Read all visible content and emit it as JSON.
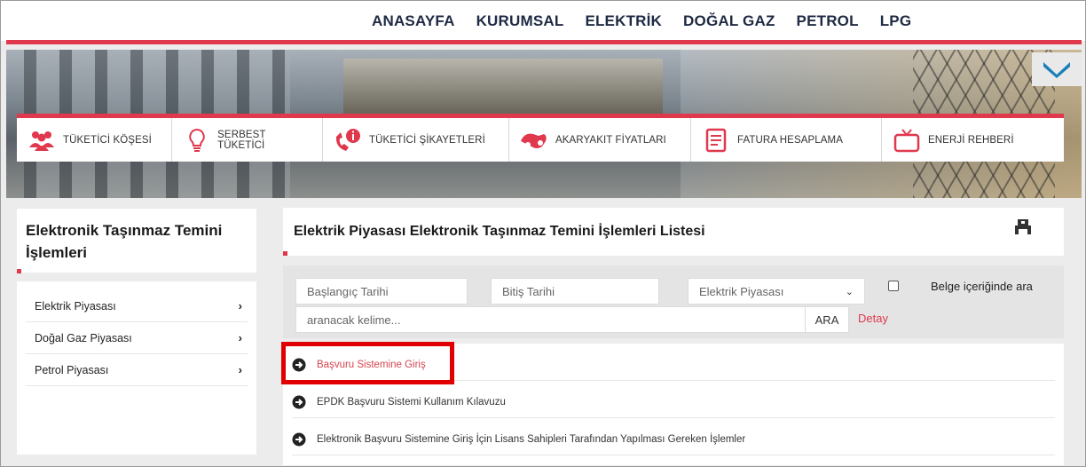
{
  "nav": {
    "items": [
      "ANASAYFA",
      "KURUMSAL",
      "ELEKTRİK",
      "DOĞAL GAZ",
      "PETROL",
      "LPG"
    ]
  },
  "categories": [
    {
      "label": "TÜKETİCİ KÖŞESİ",
      "icon": "people-icon"
    },
    {
      "label": "SERBEST TÜKETİCİ",
      "icon": "lightbulb-icon"
    },
    {
      "label": "TÜKETİCİ ŞİKAYETLERİ",
      "icon": "phone-info-icon"
    },
    {
      "label": "AKARYAKIT FİYATLARI",
      "icon": "fuel-pump-icon"
    },
    {
      "label": "FATURA HESAPLAMA",
      "icon": "invoice-icon"
    },
    {
      "label": "ENERJİ REHBERİ",
      "icon": "tv-icon"
    }
  ],
  "sidebar": {
    "title": "Elektronik Taşınmaz Temini İşlemleri",
    "items": [
      "Elektrik Piyasası",
      "Doğal Gaz Piyasası",
      "Petrol Piyasası"
    ]
  },
  "main": {
    "title": "Elektrik Piyasası Elektronik Taşınmaz Temini İşlemleri Listesi",
    "filter": {
      "start_date_placeholder": "Başlangıç Tarihi",
      "end_date_placeholder": "Bitiş Tarihi",
      "market_selected": "Elektrik Piyasası",
      "search_in_docs_label": "Belge içeriğinde ara",
      "keyword_placeholder": "aranacak kelime...",
      "search_button": "ARA",
      "detail_link": "Detay"
    },
    "list": [
      "Başvuru Sistemine Giriş",
      "EPDK Başvuru Sistemi Kullanım Kılavuzu",
      "Elektronik Başvuru Sistemine Giriş İçin Lisans Sahipleri Tarafından Yapılması Gereken İşlemler"
    ]
  },
  "colors": {
    "accent": "#e0384d",
    "highlight": "#e00000",
    "nav_text": "#1f2a44"
  }
}
